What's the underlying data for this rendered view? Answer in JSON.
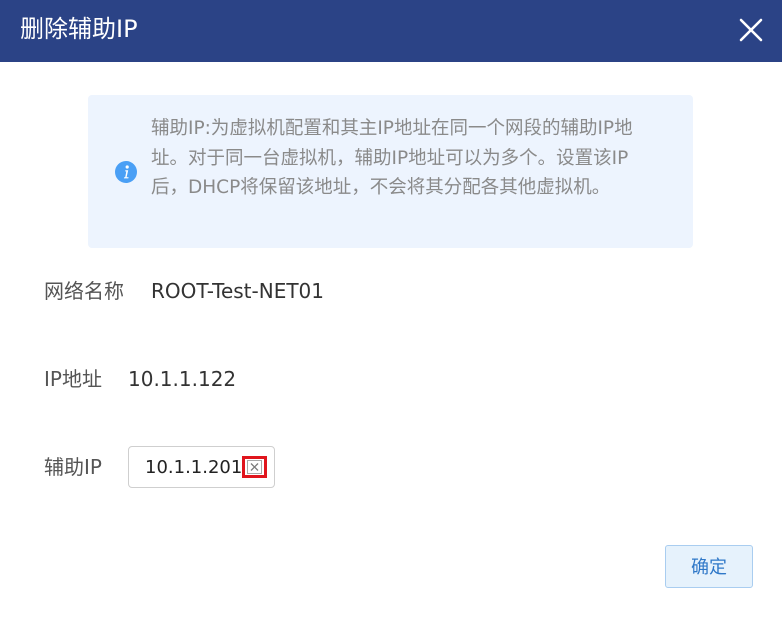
{
  "dialog": {
    "title": "删除辅助IP",
    "close_icon": "close-icon"
  },
  "info": {
    "icon": "info-icon",
    "text": "辅助IP:为虚拟机配置和其主IP地址在同一个网段的辅助IP地址。对于同一台虚拟机，辅助IP地址可以为多个。设置该IP后，DHCP将保留该地址，不会将其分配各其他虚拟机。"
  },
  "fields": {
    "network_name_label": "网络名称",
    "network_name_value": "ROOT-Test-NET01",
    "ip_label": "IP地址",
    "ip_value": "10.1.1.122",
    "secondary_ip_label": "辅助IP",
    "secondary_ips": [
      "10.1.1.201"
    ]
  },
  "footer": {
    "confirm_label": "确定"
  },
  "colors": {
    "titlebar": "#2b4386",
    "info_background": "#edf4fe",
    "info_icon": "#4a9ff5",
    "remove_highlight": "#e0151d",
    "confirm_text": "#2f78c8"
  }
}
